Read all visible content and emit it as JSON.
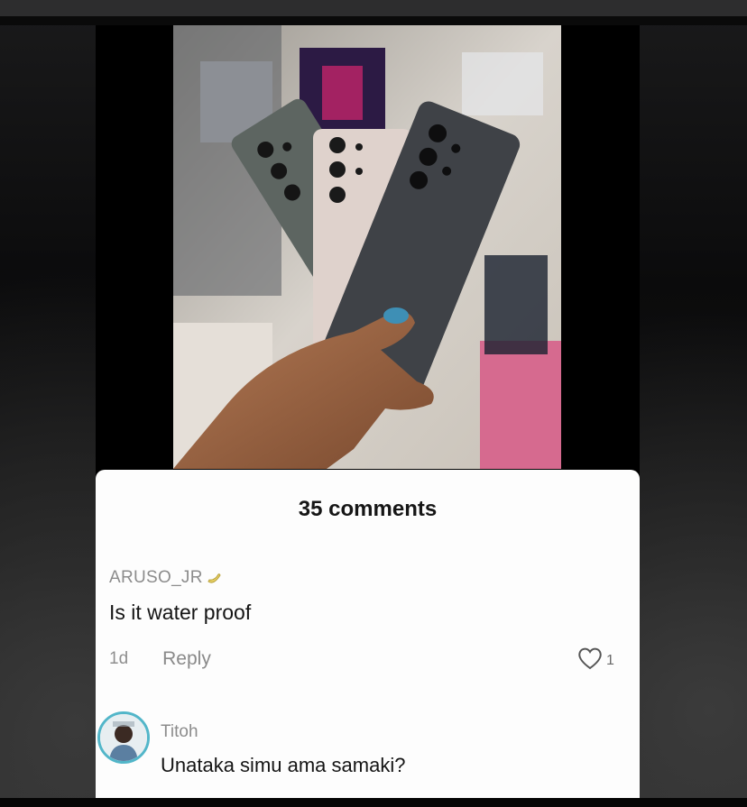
{
  "comments_header": {
    "title": "35 comments"
  },
  "comments": [
    {
      "username": "ARUSO_JR",
      "badge_icon": "banana-emoji-icon",
      "text": "Is it water proof",
      "time": "1d",
      "reply_label": "Reply",
      "like_icon": "heart-icon",
      "like_count": "1"
    },
    {
      "username": "Titoh",
      "text": "Unataka simu ama samaki?"
    }
  ],
  "colors": {
    "avatar_ring": "#52b6c9",
    "sheet_bg": "#fdfdfd",
    "muted_text": "#8c8c8c"
  }
}
